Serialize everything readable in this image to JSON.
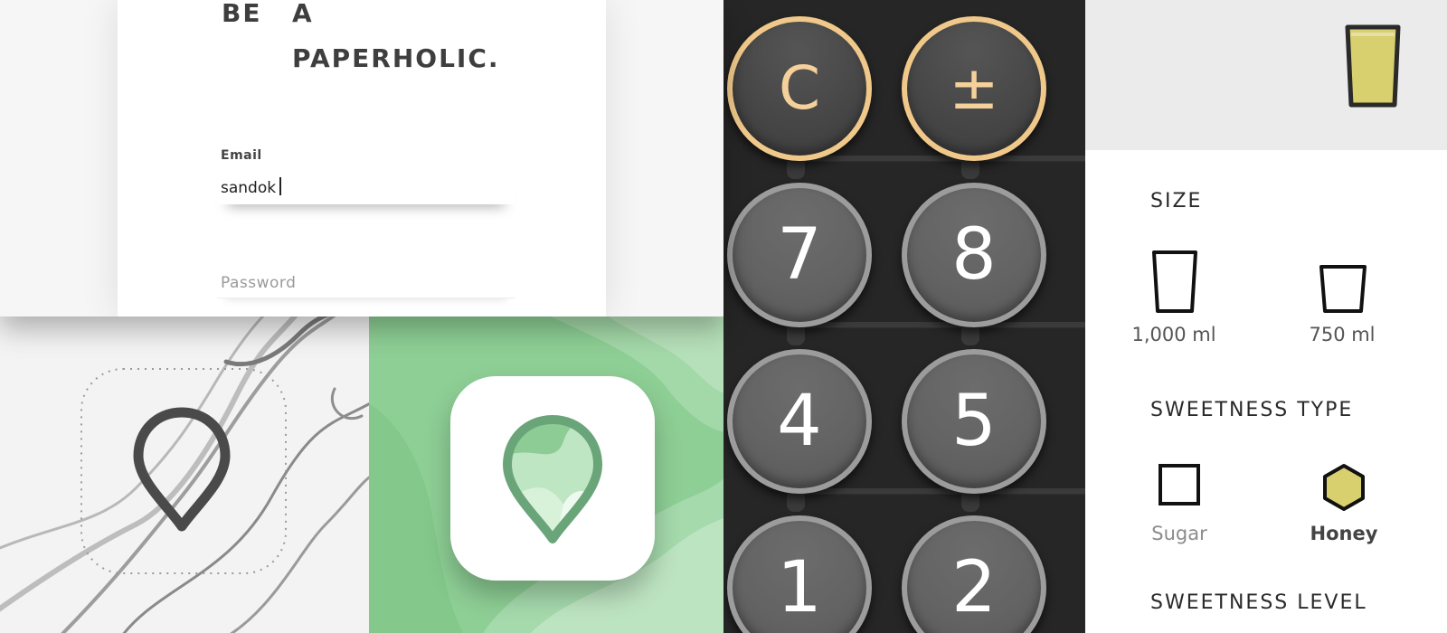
{
  "login": {
    "headline_words": [
      "BE",
      "A",
      "PAPERHOLIC."
    ],
    "email_label": "Email",
    "email_value": "sandok",
    "password_placeholder": "Password"
  },
  "calculator": {
    "buttons": [
      {
        "label": "C",
        "kind": "function"
      },
      {
        "label": "±",
        "kind": "function"
      },
      {
        "label": "7",
        "kind": "number"
      },
      {
        "label": "8",
        "kind": "number"
      },
      {
        "label": "4",
        "kind": "number"
      },
      {
        "label": "5",
        "kind": "number"
      },
      {
        "label": "1",
        "kind": "number"
      },
      {
        "label": "2",
        "kind": "number"
      }
    ]
  },
  "drink": {
    "size_title": "SIZE",
    "sizes": [
      {
        "label": "1,000 ml"
      },
      {
        "label": "750 ml"
      }
    ],
    "sweetness_type_title": "SWEETNESS TYPE",
    "sweetness_types": [
      {
        "label": "Sugar",
        "selected": false
      },
      {
        "label": "Honey",
        "selected": true
      }
    ],
    "sweetness_level_title": "SWEETNESS LEVEL"
  },
  "colors": {
    "calc_accent": "#f0c98a",
    "honey": "#d8cf6e",
    "icon_green": "#8ecf95",
    "pin_green": "#6aa57a"
  },
  "icons": [
    "map-pin-icon",
    "glass-icon",
    "hexagon-icon",
    "square-icon"
  ]
}
